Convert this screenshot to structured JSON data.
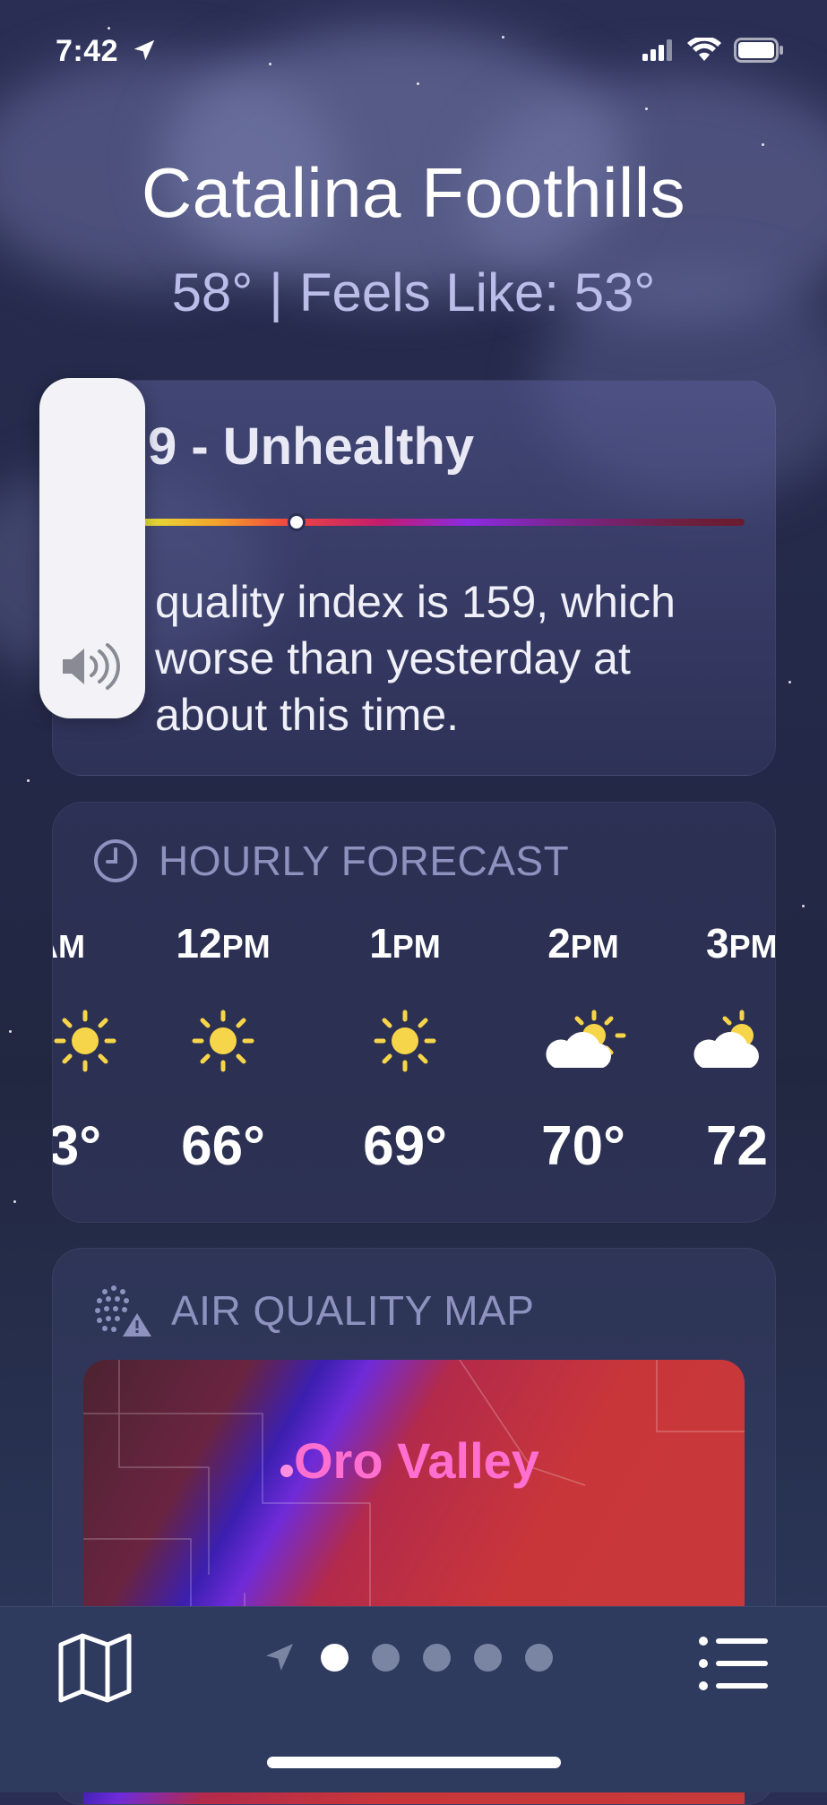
{
  "status_bar": {
    "time": "7:42"
  },
  "header": {
    "city": "Catalina Foothills",
    "temperature": "58°",
    "separator": "|",
    "feels_like": "Feels Like: 53°"
  },
  "aqi_card": {
    "title_visible": "9 - Unhealthy",
    "scale_level_fraction": 0.32,
    "description_visible": "quality index is 159, which worse than yesterday at about this time."
  },
  "hourly_card": {
    "heading": "HOURLY FORECAST",
    "hours": [
      {
        "time": "AM",
        "icon": "sun-icon",
        "temp": "3°"
      },
      {
        "time": "12PM",
        "icon": "sun-icon",
        "temp": "66°"
      },
      {
        "time": "1PM",
        "icon": "sun-icon",
        "temp": "69°"
      },
      {
        "time": "2PM",
        "icon": "partly-cloudy-icon",
        "temp": "70°"
      },
      {
        "time": "3PM",
        "icon": "partly-cloudy-icon",
        "temp": "72"
      }
    ]
  },
  "map_card": {
    "heading": "AIR QUALITY MAP",
    "map_label": "Oro Valley"
  },
  "tab_bar": {
    "page_count": 5,
    "active_page": 1
  },
  "colors": {
    "background_top": "#2a2e55",
    "tab_bar": "#2e3a5e",
    "section_heading": "#8d92bf",
    "sun": "#f7d54a",
    "map_label": "#ff6fcf"
  }
}
